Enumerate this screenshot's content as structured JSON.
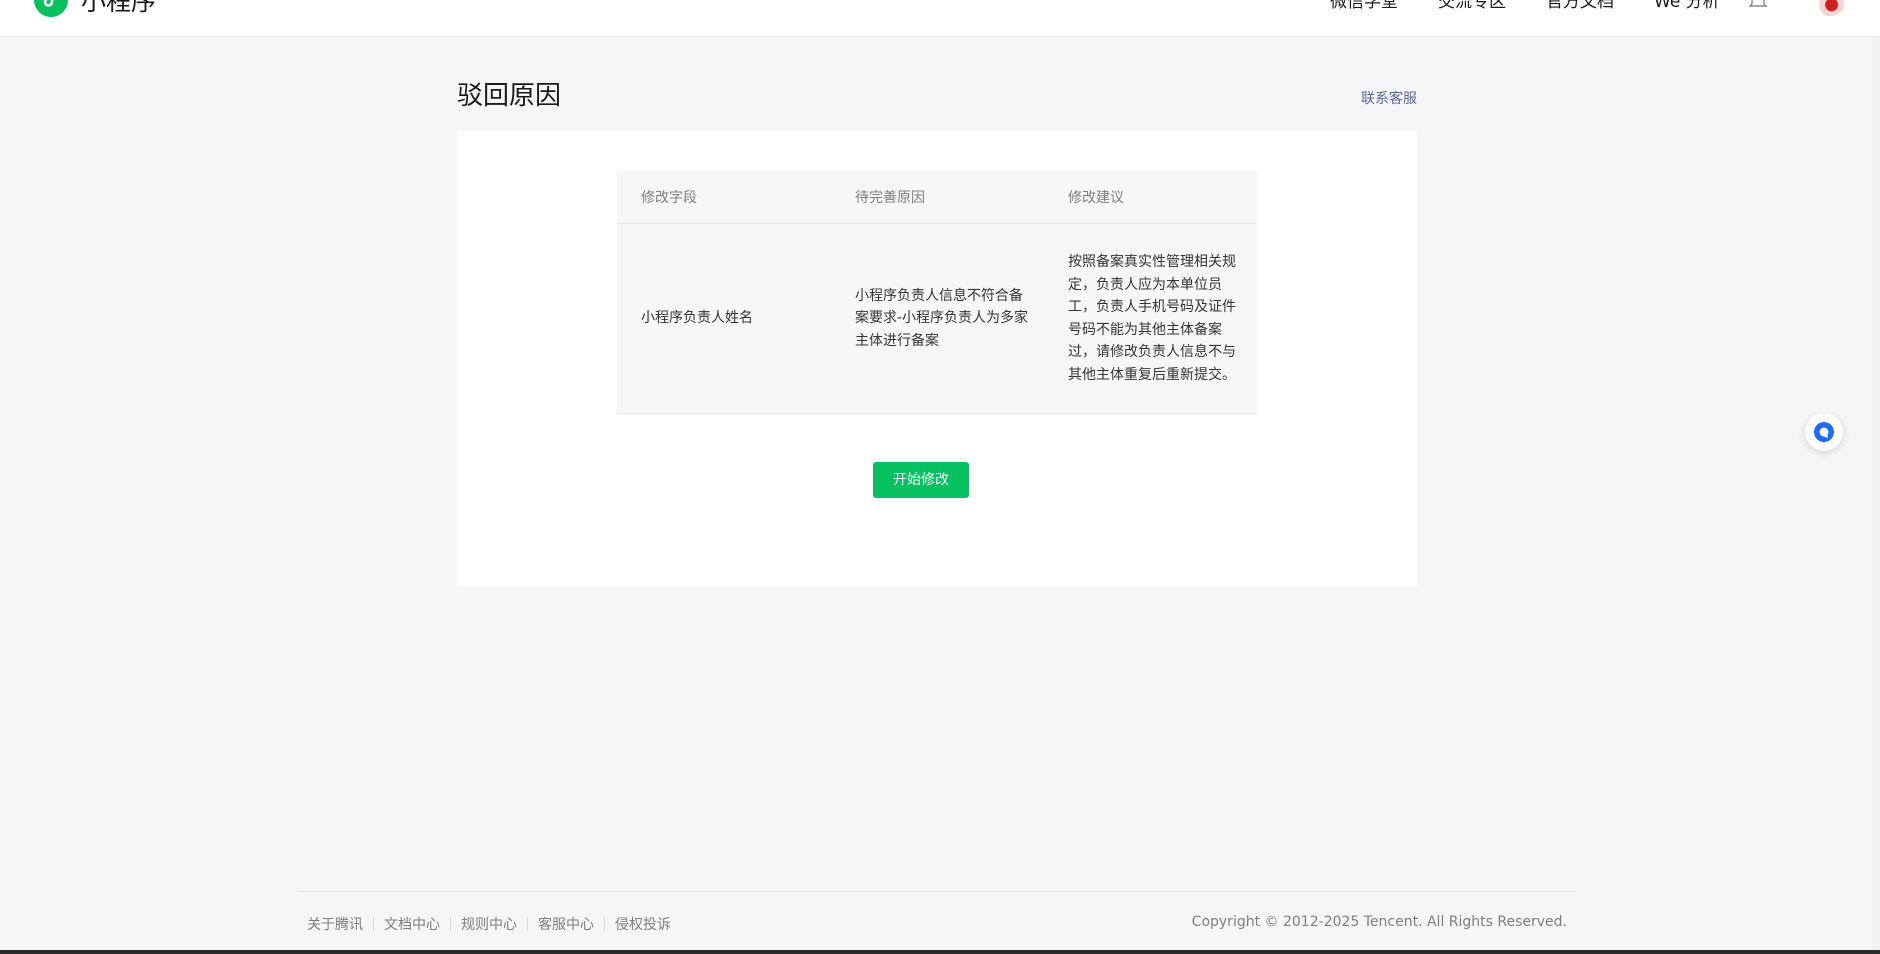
{
  "header": {
    "logo_text": "小程序",
    "nav": [
      "微信学堂",
      "交流专区",
      "官方文档",
      "We 分析"
    ]
  },
  "page": {
    "title": "驳回原因",
    "contact_link": "联系客服"
  },
  "table": {
    "headers": [
      "修改字段",
      "待完善原因",
      "修改建议"
    ],
    "rows": [
      {
        "field": "小程序负责人姓名",
        "reason": "小程序负责人信息不符合备案要求-小程序负责人为多家主体进行备案",
        "suggestion": "按照备案真实性管理相关规定，负责人应为本单位员工，负责人手机号码及证件号码不能为其他主体备案过，请修改负责人信息不与其他主体重复后重新提交。"
      }
    ]
  },
  "actions": {
    "start_edit": "开始修改"
  },
  "footer": {
    "links": [
      "关于腾讯",
      "文档中心",
      "规则中心",
      "客服中心",
      "侵权投诉"
    ],
    "copyright": "Copyright © 2012-2025 Tencent. All Rights Reserved."
  },
  "colors": {
    "brand_green": "#07c160",
    "link_blue": "#576b95",
    "page_bg": "#f5f6f7"
  },
  "icons": {
    "logo": "miniprogram-logo-icon",
    "bell": "bell-icon",
    "help": "chat-help-icon"
  }
}
